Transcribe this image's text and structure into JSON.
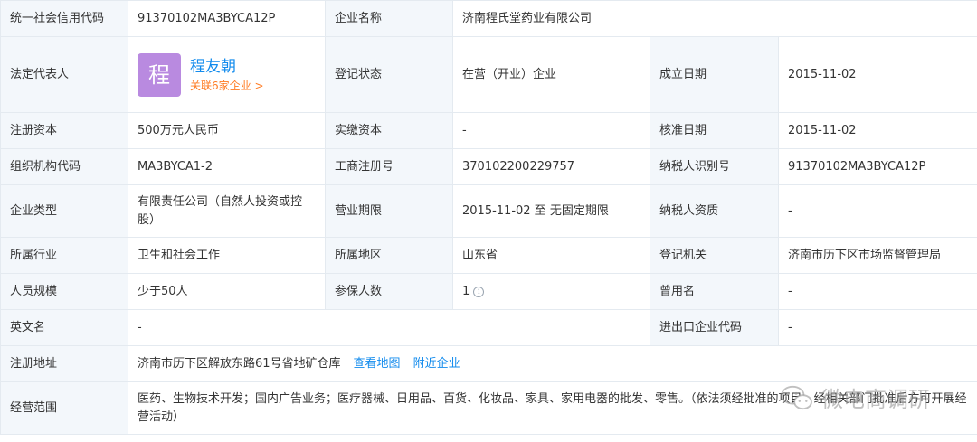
{
  "rows": {
    "credit_code": {
      "label": "统一社会信用代码",
      "value": "91370102MA3BYCA12P",
      "label2": "企业名称",
      "value2": "济南程氏堂药业有限公司"
    },
    "legal": {
      "label": "法定代表人",
      "avatar_char": "程",
      "name": "程友朝",
      "related": "关联6家企业 >",
      "label2": "登记状态",
      "value2": "在营（开业）企业",
      "label3": "成立日期",
      "value3": "2015-11-02"
    },
    "capital": {
      "label": "注册资本",
      "value": "500万元人民币",
      "label2": "实缴资本",
      "value2": "-",
      "label3": "核准日期",
      "value3": "2015-11-02"
    },
    "org_code": {
      "label": "组织机构代码",
      "value": "MA3BYCA1-2",
      "label2": "工商注册号",
      "value2": "370102200229757",
      "label3": "纳税人识别号",
      "value3": "91370102MA3BYCA12P"
    },
    "type": {
      "label": "企业类型",
      "value": "有限责任公司（自然人投资或控股）",
      "label2": "营业期限",
      "value2": "2015-11-02 至 无固定期限",
      "label3": "纳税人资质",
      "value3": "-"
    },
    "industry": {
      "label": "所属行业",
      "value": "卫生和社会工作",
      "label2": "所属地区",
      "value2": "山东省",
      "label3": "登记机关",
      "value3": "济南市历下区市场监督管理局"
    },
    "staff": {
      "label": "人员规模",
      "value": "少于50人",
      "label2": "参保人数",
      "value2": "1",
      "label3": "曾用名",
      "value3": "-"
    },
    "english": {
      "label": "英文名",
      "value": "-",
      "label3": "进出口企业代码",
      "value3": "-"
    },
    "address": {
      "label": "注册地址",
      "value": "济南市历下区解放东路61号省地矿仓库",
      "map_link": "查看地图",
      "nearby_link": "附近企业"
    },
    "scope": {
      "label": "经营范围",
      "value": "医药、生物技术开发；国内广告业务；医疗器械、日用品、百货、化妆品、家具、家用电器的批发、零售。（依法须经批准的项目，经相关部门批准后方可开展经营活动）"
    }
  },
  "icons": {
    "info": "info-circle-icon",
    "watermark": "wechat-logo-icon"
  },
  "colors": {
    "label_bg": "#f3f7fb",
    "border": "#e4eaf0",
    "link": "#128bed",
    "related": "#ff7a21",
    "avatar": "#b98ae0"
  },
  "watermark_text": "微电商调研"
}
